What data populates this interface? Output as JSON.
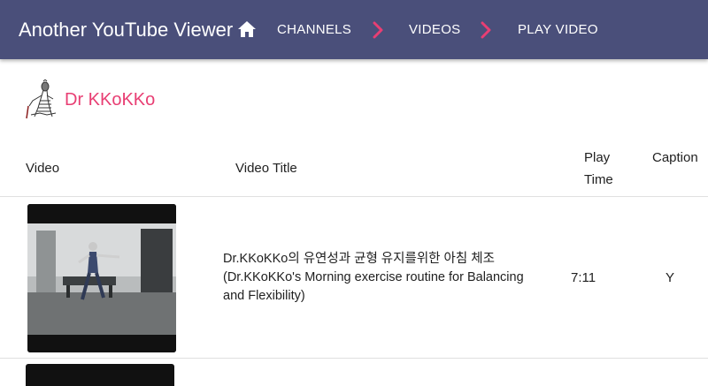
{
  "app": {
    "title": "Another YouTube Viewer"
  },
  "nav": {
    "home_icon": "home-icon",
    "breadcrumbs": [
      "CHANNELS",
      "VIDEOS",
      "PLAY VIDEO"
    ],
    "separator_icon": "chevron-right-icon",
    "separator_color": "#e83e73"
  },
  "channel": {
    "name": "Dr KKoKKo",
    "avatar_icon": "avatar-illustration"
  },
  "table": {
    "headers": {
      "video": "Video",
      "title": "Video Title",
      "play_time_line1": "Play",
      "play_time_line2": "Time",
      "caption": "Caption"
    },
    "rows": [
      {
        "title_line1": "Dr.KKoKKo의 유연성과 균형 유지를위한 아침 체조",
        "title_line2": "(Dr.KKoKKo's Morning exercise routine for Balancing",
        "title_line3": "and Flexibility)",
        "play_time": "7:11",
        "caption": "Y"
      }
    ]
  },
  "colors": {
    "appbar": "#4a4f7a",
    "accent": "#e83e73",
    "text": "#212121"
  }
}
